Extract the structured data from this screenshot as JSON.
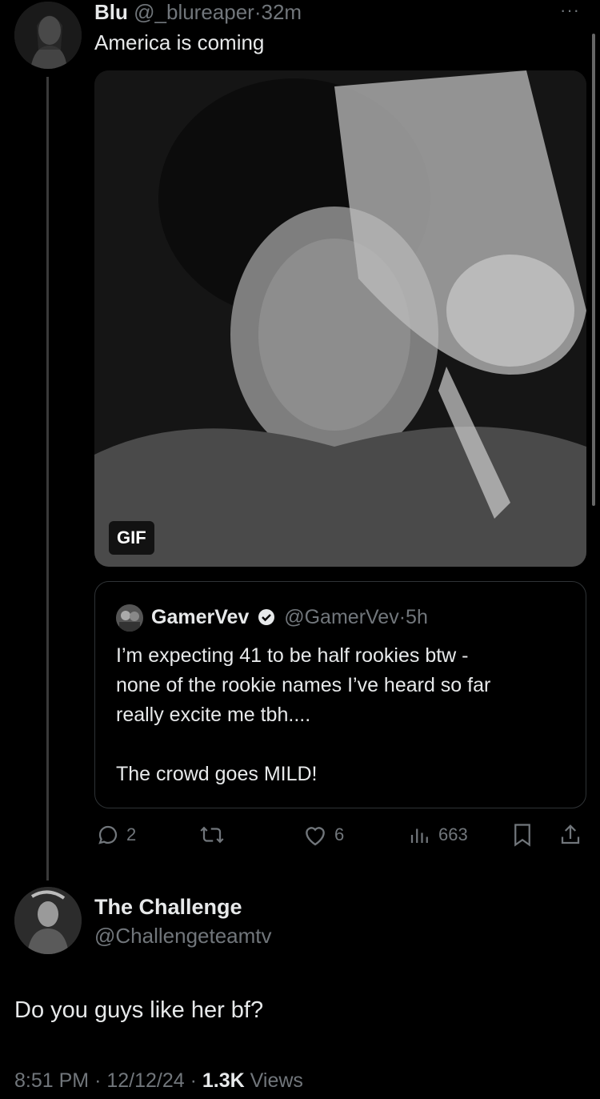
{
  "post": {
    "display_name": "Blu",
    "handle": "@_blureaper",
    "separator": "·",
    "time": "32m",
    "text": "America is coming",
    "more_icon": "ellipsis-icon",
    "media": {
      "badge": "GIF"
    },
    "quote": {
      "display_name": "GamerVev",
      "handle": "@GamerVev",
      "separator": "·",
      "time": "5h",
      "text_lines": [
        "I’m expecting 41 to be half rookies btw -",
        "none of the rookie names I’ve heard so far",
        "really excite me tbh...."
      ],
      "text_after": "The crowd goes MILD!"
    },
    "actions": {
      "replies": "2",
      "reposts": "",
      "likes": "6",
      "views": "663"
    }
  },
  "reply": {
    "display_name": "The Challenge",
    "handle": "@Challengeteamtv",
    "text": "Do you guys like her bf?",
    "time": "8:51 PM",
    "date": "12/12/24",
    "views_count": "1.3K",
    "views_label": "Views",
    "sep": "·"
  }
}
